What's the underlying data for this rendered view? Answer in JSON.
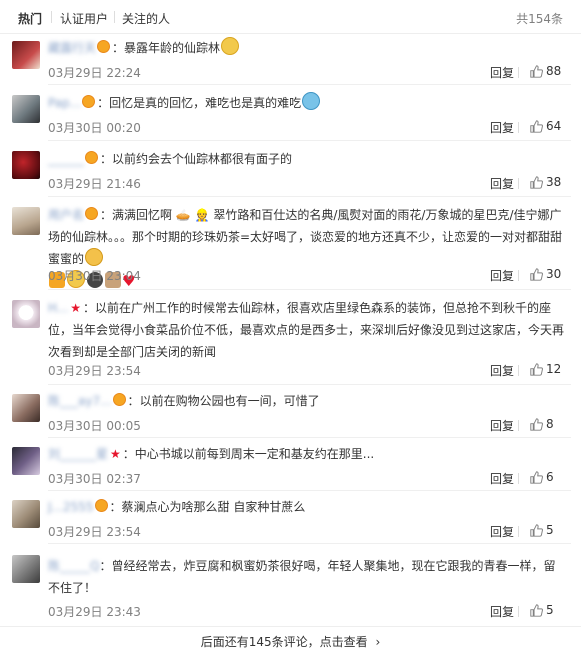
{
  "tabs": [
    "热门",
    "认证用户",
    "关注的人"
  ],
  "total": "共154条",
  "reply_label": "回复",
  "comments": [
    {
      "user": "藏露行天",
      "text": "暴露年龄的仙踪林",
      "time": "03月29日 22:24",
      "likes": "88",
      "badge": "vip",
      "emojis": [
        "face"
      ]
    },
    {
      "user": "Pap...",
      "text": "回忆是真的回忆，难吃也是真的难吃",
      "time": "03月30日 00:20",
      "likes": "64",
      "badge": "vip",
      "emojis": [
        "laugh"
      ]
    },
    {
      "user": "______",
      "text": "以前约会去个仙踪林都很有面子的",
      "time": "03月29日 21:46",
      "likes": "38",
      "badge": "vip",
      "emojis": []
    },
    {
      "user": "用户名",
      "text": "满满回忆啊 🥧 👷 翠竹路和百仕达的名典/風熨对面的雨花/万象城的星巴克/佳宁娜广场的仙踪林。。。那个时期的珍珠奶茶=太好喝了，谈恋爱的地方还真不少，让恋爱的一对对都甜甜蜜蜜的",
      "time": "03月30日 23:04",
      "likes": "30",
      "badge": "vip",
      "emojis": [
        "smile",
        "gift",
        "kiss",
        "dark",
        "dog",
        "heart"
      ]
    },
    {
      "user": "H...",
      "text": "以前在广州工作的时候常去仙踪林，很喜欢店里绿色森系的装饰，但总抢不到秋千的座位，当年会觉得小食菜品价位不低，最喜欢点的是西多士，来深圳后好像没见到过这家店，今天再次看到却是全部门店关闭的新闻",
      "time": "03月29日 23:54",
      "likes": "12",
      "badge": "star",
      "emojis": []
    },
    {
      "user": "陈___ay7...",
      "text": "以前在购物公园也有一间，可惜了",
      "time": "03月30日 00:05",
      "likes": "8",
      "badge": "vip",
      "emojis": []
    },
    {
      "user": "刘______星",
      "text": "中心书城以前每到周末一定和基友约在那里...",
      "time": "03月30日 02:37",
      "likes": "6",
      "badge": "star",
      "emojis": []
    },
    {
      "user": "J...2555",
      "text": "蔡澜点心为啥那么甜 自家种甘蔗么",
      "time": "03月29日 23:54",
      "likes": "5",
      "badge": "vip",
      "emojis": []
    },
    {
      "user": "陈_____Q",
      "text": "曾经经常去，炸豆腐和枫蜜奶茶很好喝，年轻人聚集地，现在它跟我的青春一样，留不住了！",
      "time": "03月29日 23:43",
      "likes": "5",
      "badge": "none",
      "emojis": []
    }
  ],
  "more_text": "后面还有145条评论，点击查看",
  "colors": {
    "link": "#8aa3c9",
    "meta": "#808080",
    "badge": "#f6a623",
    "star": "#e6162d"
  }
}
